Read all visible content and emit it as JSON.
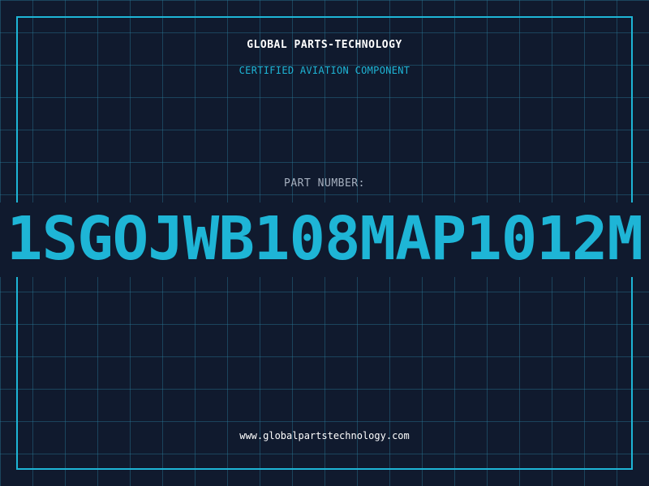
{
  "header": {
    "company": "GLOBAL PARTS-TECHNOLOGY",
    "tagline": "CERTIFIED AVIATION COMPONENT"
  },
  "part": {
    "label": "PART NUMBER:",
    "number": "1SGOJWB108MAP1012M"
  },
  "footer": {
    "website": "www.globalpartstechnology.com"
  },
  "colors": {
    "background": "#101a2e",
    "accent": "#1eb5d6",
    "grid": "#28789a",
    "text": "#ffffff",
    "muted": "#a6b0bf"
  }
}
